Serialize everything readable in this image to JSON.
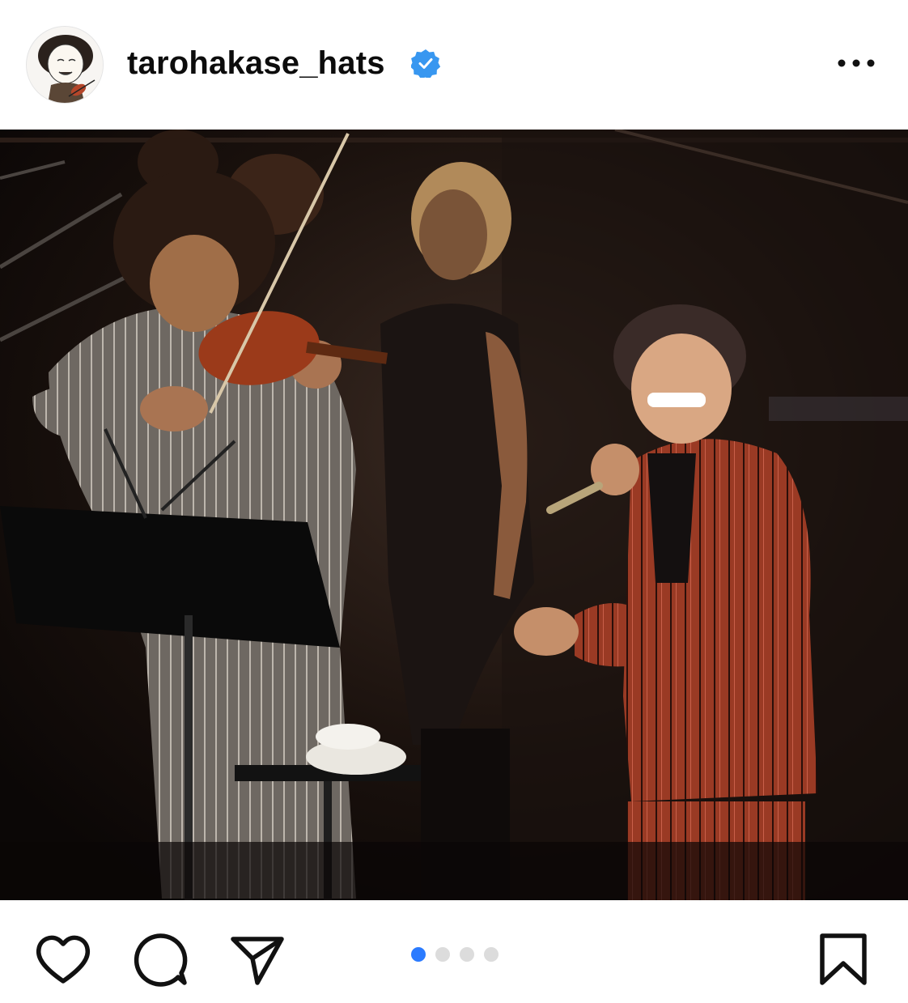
{
  "post": {
    "username": "tarohakase_hats",
    "verified": true,
    "icons": {
      "avatar": "illustrated-violinist-avatar",
      "verified": "verified-badge-icon",
      "more": "more-options-icon",
      "like": "heart-icon",
      "comment": "comment-bubble-icon",
      "share": "paper-plane-icon",
      "save": "bookmark-icon"
    },
    "carousel": {
      "total": 4,
      "current": 1
    },
    "colors": {
      "verified_blue": "#3897f0",
      "active_dot": "#2b7bff",
      "inactive_dot": "#dcdcdc"
    }
  }
}
